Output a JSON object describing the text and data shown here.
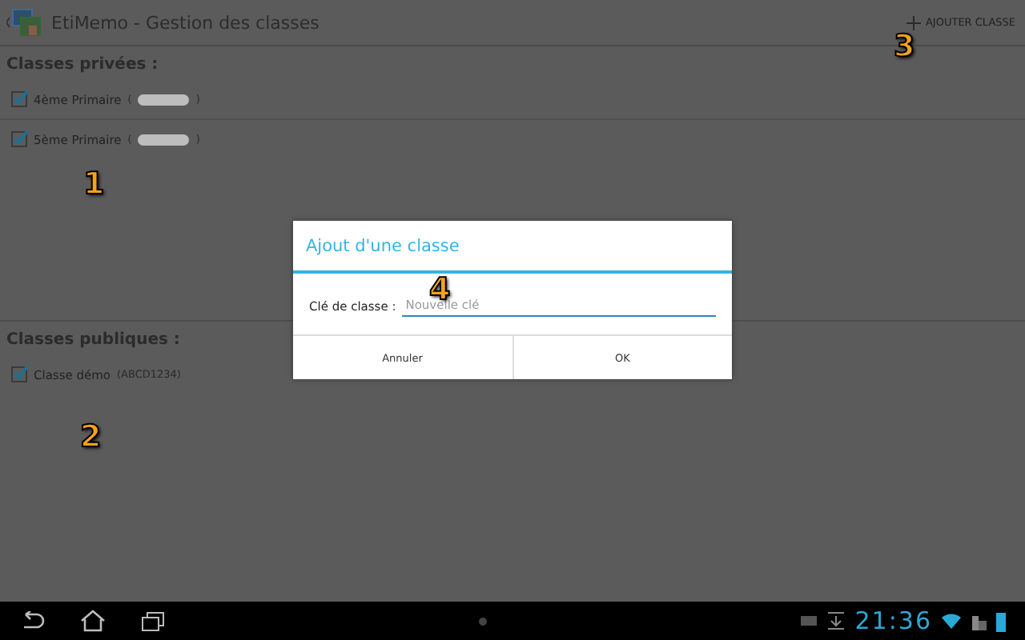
{
  "action_bar": {
    "title": "EtiMemo - Gestion des classes",
    "action": "AJOUTER CLASSE"
  },
  "sections": [
    {
      "heading": "Classes privées :",
      "items": [
        {
          "label": "4ème Primaire",
          "code_before": "(",
          "redacted": true,
          "code_after": ")",
          "checked": true
        },
        {
          "label": "5ème Primaire",
          "code_before": "(",
          "redacted": true,
          "code_after": ")",
          "checked": true
        }
      ]
    },
    {
      "heading": "Classes publiques :",
      "items": [
        {
          "label": "Classe démo",
          "code_before": "(ABCD1234)",
          "redacted": false,
          "checked": true
        }
      ]
    }
  ],
  "dialog": {
    "title": "Ajout d'une classe",
    "field_label": "Clé de classe :",
    "placeholder": "Nouvelle clé",
    "buttons": [
      "Annuler",
      "OK"
    ]
  },
  "callouts": [
    "1",
    "2",
    "3",
    "4"
  ],
  "nav_bar": {
    "time": "21:36"
  }
}
